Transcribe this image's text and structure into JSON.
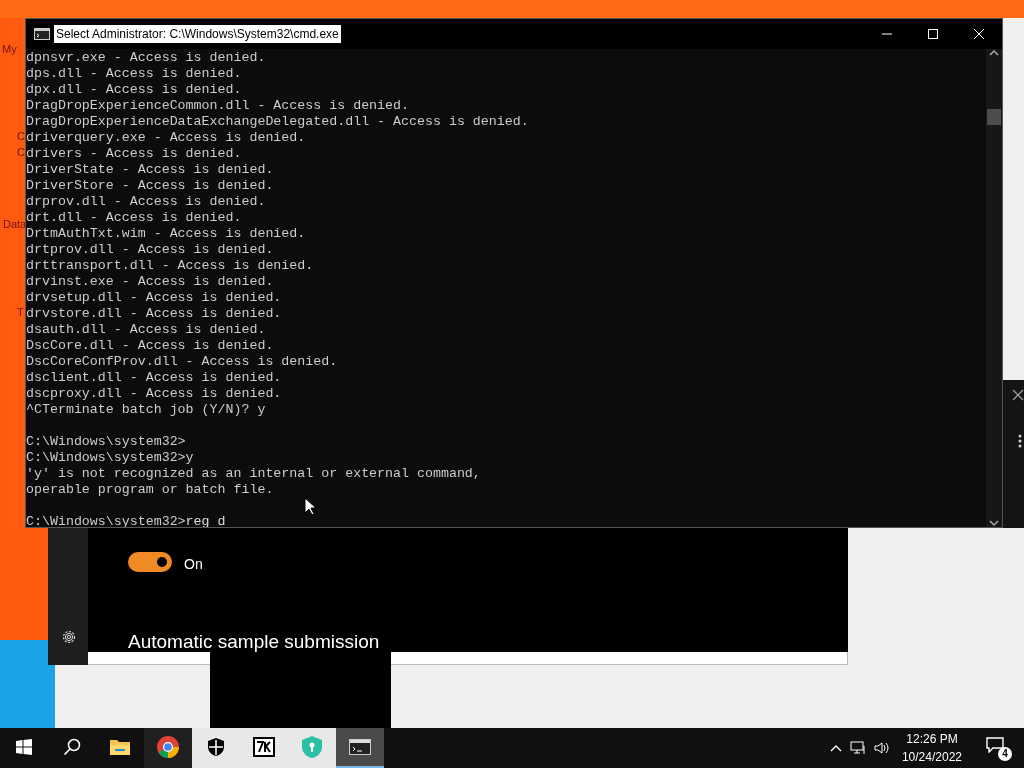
{
  "desktop": {
    "icon_labels": [
      "My",
      "C",
      "C",
      "Data",
      "T"
    ]
  },
  "console": {
    "title": "Select Administrator:  C:\\Windows\\System32\\cmd.exe",
    "blocks": [
      [
        "dpnsvr.exe - Access is denied.",
        "dps.dll - Access is denied.",
        "dpx.dll - Access is denied.",
        "DragDropExperienceCommon.dll - Access is denied.",
        "DragDropExperienceDataExchangeDelegated.dll - Access is denied.",
        "driverquery.exe - Access is denied.",
        "drivers - Access is denied.",
        "DriverState - Access is denied.",
        "DriverStore - Access is denied.",
        "drprov.dll - Access is denied.",
        "drt.dll - Access is denied.",
        "DrtmAuthTxt.wim - Access is denied.",
        "drtprov.dll - Access is denied.",
        "drttransport.dll - Access is denied.",
        "drvinst.exe - Access is denied.",
        "drvsetup.dll - Access is denied.",
        "drvstore.dll - Access is denied.",
        "dsauth.dll - Access is denied.",
        "DscCore.dll - Access is denied.",
        "DscCoreConfProv.dll - Access is denied.",
        "dsclient.dll - Access is denied.",
        "dscproxy.dll - Access is denied.",
        "^CTerminate batch job (Y/N)? y"
      ],
      [
        "C:\\Windows\\system32>",
        "C:\\Windows\\system32>y",
        "'y' is not recognized as an internal or external command,",
        "operable program or batch file."
      ]
    ],
    "prompt": "C:\\Windows\\system32>",
    "input": "reg d"
  },
  "settings_panel": {
    "toggle": {
      "on": true,
      "label": "On"
    },
    "heading": "Automatic sample submission"
  },
  "taskbar": {
    "apps": [
      {
        "kind": "start",
        "active": false
      },
      {
        "kind": "search",
        "active": false
      },
      {
        "kind": "folder",
        "active": false
      },
      {
        "kind": "chrome",
        "active": false
      },
      {
        "kind": "shield",
        "active": false
      },
      {
        "kind": "archiver",
        "active": false
      },
      {
        "kind": "defender",
        "active": false
      },
      {
        "kind": "console",
        "active": true
      }
    ],
    "time": "12:26 PM",
    "date": "10/24/2022",
    "notifications": "4"
  }
}
